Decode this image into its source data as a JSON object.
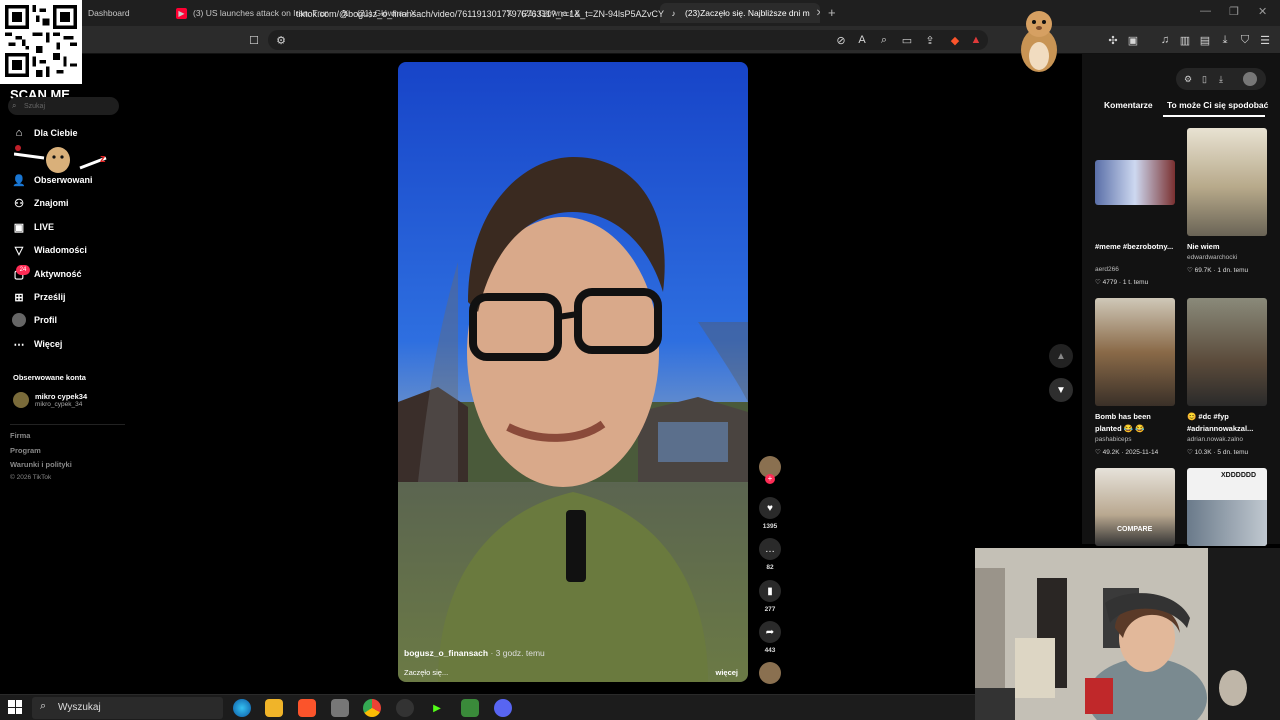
{
  "browser": {
    "tabs": [
      {
        "title": "Dashboard",
        "icon": "dashboard-icon",
        "active": false
      },
      {
        "title": "(3) US launches attack on Iran, Trump",
        "icon": "youtube-icon",
        "active": false
      },
      {
        "title": "(21) Główna / X",
        "icon": "x-icon",
        "active": false
      },
      {
        "title": "(21) Główna / X",
        "icon": "x-icon",
        "active": false
      },
      {
        "title": "(23)Zaczęło się. Najbliższe dni m",
        "icon": "tiktok-icon",
        "active": true
      }
    ],
    "url": "tiktok.com/@bogusz_o_finansach/video/7611913017797676311?_r=1&_t=ZN-94lsP5AZvCY"
  },
  "overlay": {
    "scan_label": "SCAN ME"
  },
  "sidebar": {
    "search_placeholder": "Szukaj",
    "items": [
      {
        "label": "Dla Ciebie",
        "icon": "home-icon"
      },
      {
        "label": "Obserwowani",
        "icon": "following-icon"
      },
      {
        "label": "Znajomi",
        "icon": "friends-icon"
      },
      {
        "label": "LIVE",
        "icon": "live-icon"
      },
      {
        "label": "Wiadomości",
        "icon": "messages-icon"
      },
      {
        "label": "Aktywność",
        "icon": "activity-icon"
      },
      {
        "label": "Prześlij",
        "icon": "upload-icon"
      },
      {
        "label": "Profil",
        "icon": "profile-icon"
      },
      {
        "label": "Więcej",
        "icon": "more-icon"
      }
    ],
    "activity_badge": "24",
    "followed_header": "Obserwowane konta",
    "followed": {
      "name": "mikro cypek34",
      "handle": "mikro_cypek_34"
    },
    "footer": [
      "Firma",
      "Program",
      "Warunki i polityki"
    ],
    "copyright": "© 2026 TikTok"
  },
  "video": {
    "author": "bogusz_o_finansach",
    "time_ago": "· 3 godz. temu",
    "caption": "Zaczęło się...",
    "more_label": "więcej",
    "likes": "1395",
    "comments": "82",
    "saves": "277",
    "shares": "443"
  },
  "right_panel": {
    "tab_comments": "Komentarze",
    "tab_recommended": "To może Ci się spodobać",
    "cards": [
      {
        "title": "#meme #bezrobotny...",
        "user": "aerd266",
        "likes": "4779",
        "age": "1 t. temu"
      },
      {
        "title": "Nie wiem",
        "user": "edwardwarchocki",
        "likes": "69.7K",
        "age": "1 dn. temu"
      },
      {
        "title": "Bomb has been planted 😂 😂",
        "user": "pashabiceps",
        "likes": "49.2K",
        "age": "2025-11-14"
      },
      {
        "title": "😊 #dc #fyp #adriannowakzal...",
        "user": "adrian.nowak.zalno",
        "likes": "10.3K",
        "age": "5 dn. temu"
      }
    ],
    "thumb_texts": [
      "COMPARE",
      "XDDDDDD"
    ]
  },
  "taskbar": {
    "search_placeholder": "Wyszukaj"
  }
}
